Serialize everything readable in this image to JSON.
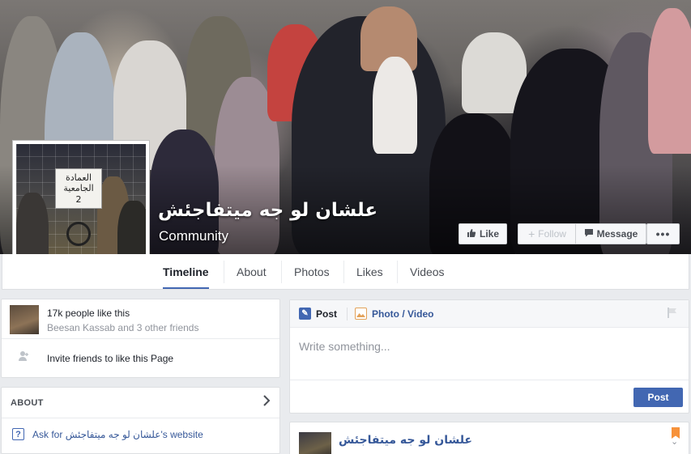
{
  "page": {
    "name": "علشان لو جه ميتفاجئش",
    "category": "Community"
  },
  "cover_actions": {
    "like": "Like",
    "follow": "Follow",
    "message": "Message",
    "more": "•••"
  },
  "profile_picture": {
    "sign_line1": "العمادة",
    "sign_line2": "الجامعية",
    "sign_line3": "2"
  },
  "tabs": [
    {
      "label": "Timeline",
      "active": true
    },
    {
      "label": "About",
      "active": false
    },
    {
      "label": "Photos",
      "active": false
    },
    {
      "label": "Likes",
      "active": false
    },
    {
      "label": "Videos",
      "active": false
    }
  ],
  "likes_card": {
    "count_text": "17k people like this",
    "friends_text": "Beesan Kassab and 3 other friends",
    "invite_text": "Invite friends to like this Page"
  },
  "about_card": {
    "title": "ABOUT",
    "website_link": "Ask for علشان لو جه ميتفاجئش's website"
  },
  "composer": {
    "tab_post": "Post",
    "tab_photo_video": "Photo / Video",
    "placeholder": "Write something...",
    "post_button": "Post"
  },
  "story": {
    "author": "علشان لو جه ميتفاجئش"
  },
  "colors": {
    "accent": "#4267b2",
    "link": "#365899",
    "background": "#e9ebee"
  }
}
